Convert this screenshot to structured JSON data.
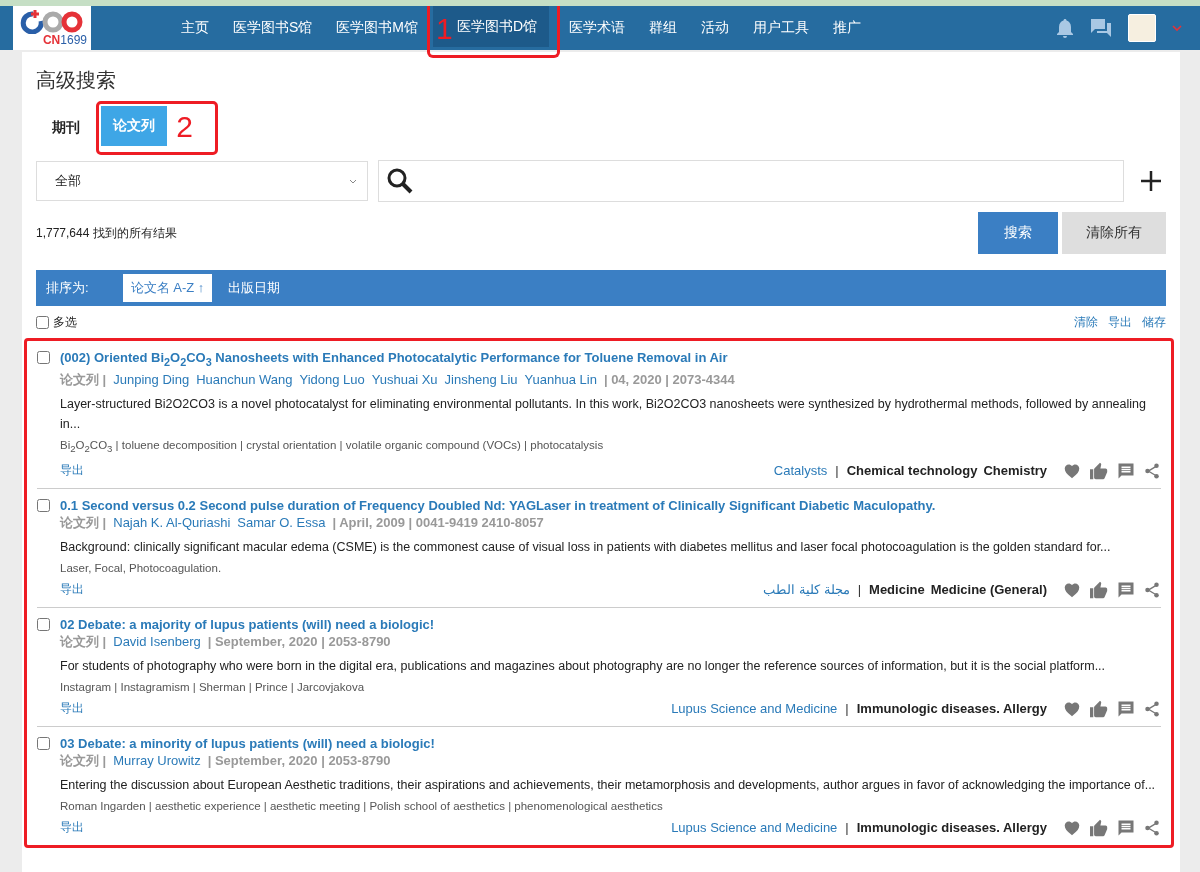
{
  "nav": {
    "logo": {
      "prefix": "CN",
      "suffix": "1699"
    },
    "items": [
      {
        "label": "主页",
        "selected": false
      },
      {
        "label": "医学图书S馆",
        "selected": false
      },
      {
        "label": "医学图书M馆",
        "selected": false
      },
      {
        "label": "医学图书D馆",
        "selected": true,
        "annotation": "1"
      },
      {
        "label": "医学术语",
        "selected": false
      },
      {
        "label": "群组",
        "selected": false
      },
      {
        "label": "活动",
        "selected": false
      },
      {
        "label": "用户工具",
        "selected": false
      },
      {
        "label": "推广",
        "selected": false
      }
    ]
  },
  "page_title": "高级搜索",
  "tabs": [
    {
      "label": "期刊",
      "selected": false
    },
    {
      "label": "论文列",
      "selected": true,
      "annotation": "2"
    }
  ],
  "search": {
    "scope": "全部"
  },
  "result_count": "1,777,644 找到的所有结果",
  "buttons": [
    {
      "label": "搜索",
      "kind": "primary"
    },
    {
      "label": "清除所有",
      "kind": "secondary"
    }
  ],
  "sort": {
    "label": "排序为:",
    "options": [
      {
        "label": "论文名 A-Z",
        "arrow": "↑",
        "selected": true
      },
      {
        "label": "出版日期",
        "selected": false
      }
    ]
  },
  "select_all": {
    "label": "多选",
    "checked": false
  },
  "list_actions": [
    "清除",
    "导出",
    "储存"
  ],
  "results_annotated": true,
  "results": [
    {
      "checked": false,
      "title": "(002) Oriented Bi$_{2}$O$_{2}$CO$_{3}$ Nanosheets with Enhanced Photocatalytic Performance for Toluene Removal in Air",
      "type": "论文列 |",
      "authors": [
        "Junping Ding",
        "Huanchun Wang",
        "Yidong Luo",
        "Yushuai Xu",
        "Jinsheng Liu",
        "Yuanhua Lin"
      ],
      "meta": "| 04, 2020 | 2073-4344",
      "abstract": "Layer-structured Bi2O2CO3 is a novel photocatalyst for eliminating environmental pollutants. In this work, Bi2O2CO3 nanosheets were synthesized by hydrothermal methods, followed by annealing in...",
      "keywords": "Bi$_{2}$O$_{2}$CO$_{3}$ | toluene decomposition | crystal orientation | volatile organic compound (VOCs) | photocatalysis",
      "export": "导出",
      "journal": "Catalysts",
      "divider": "|",
      "subjects": [
        "Chemical technology",
        "Chemistry"
      ]
    },
    {
      "checked": false,
      "title": "0.1 Second versus 0.2 Second pulse duration of Frequency Doubled Nd: YAGLaser in treatment of Clinically Significant Diabetic Maculopathy.",
      "type": "论文列 |",
      "authors": [
        "Najah K. Al-Quriashi",
        "Samar O. Essa"
      ],
      "meta": "| April, 2009 | 0041-9419 2410-8057",
      "abstract": "Background: clinically significant macular edema (CSME) is the commonest cause of visual loss in patients with diabetes mellitus and laser focal photocoagulation is the golden standard for...",
      "keywords": "Laser, Focal, Photocoagulation.",
      "export": "导出",
      "journal": "مجلة كلية الطب",
      "divider": "|",
      "subjects": [
        "Medicine",
        "Medicine (General)"
      ]
    },
    {
      "checked": false,
      "title": "02 Debate: a majority of lupus patients (will) need a biologic!",
      "type": "论文列 |",
      "authors": [
        "David Isenberg"
      ],
      "meta": "| September, 2020 | 2053-8790",
      "abstract": "For students of photography who were born in the digital era, publications and magazines about photography are no longer the reference sources of information, but it is the social platform...",
      "keywords": "Instagram | Instagramism | Sherman | Prince | Jarcovjakova",
      "export": "导出",
      "journal": "Lupus Science and Medicine",
      "divider": "|",
      "subjects": [
        "Immunologic diseases. Allergy"
      ]
    },
    {
      "checked": false,
      "title": "03 Debate: a minority of lupus patients (will) need a biologic!",
      "type": "论文列 |",
      "authors": [
        "Murray Urowitz"
      ],
      "meta": "| September, 2020 | 2053-8790",
      "abstract": "Entering the discussion about European Aesthetic traditions, their aspirations and achievements, their metamorphosis and developments, author argues in favor of acknowledging the importance of...",
      "keywords": "Roman Ingarden | aesthetic experience | aesthetic meeting | Polish school of aesthetics | phenomenological aesthetics",
      "export": "导出",
      "journal": "Lupus Science and Medicine",
      "divider": "|",
      "subjects": [
        "Immunologic diseases. Allergy"
      ]
    }
  ]
}
